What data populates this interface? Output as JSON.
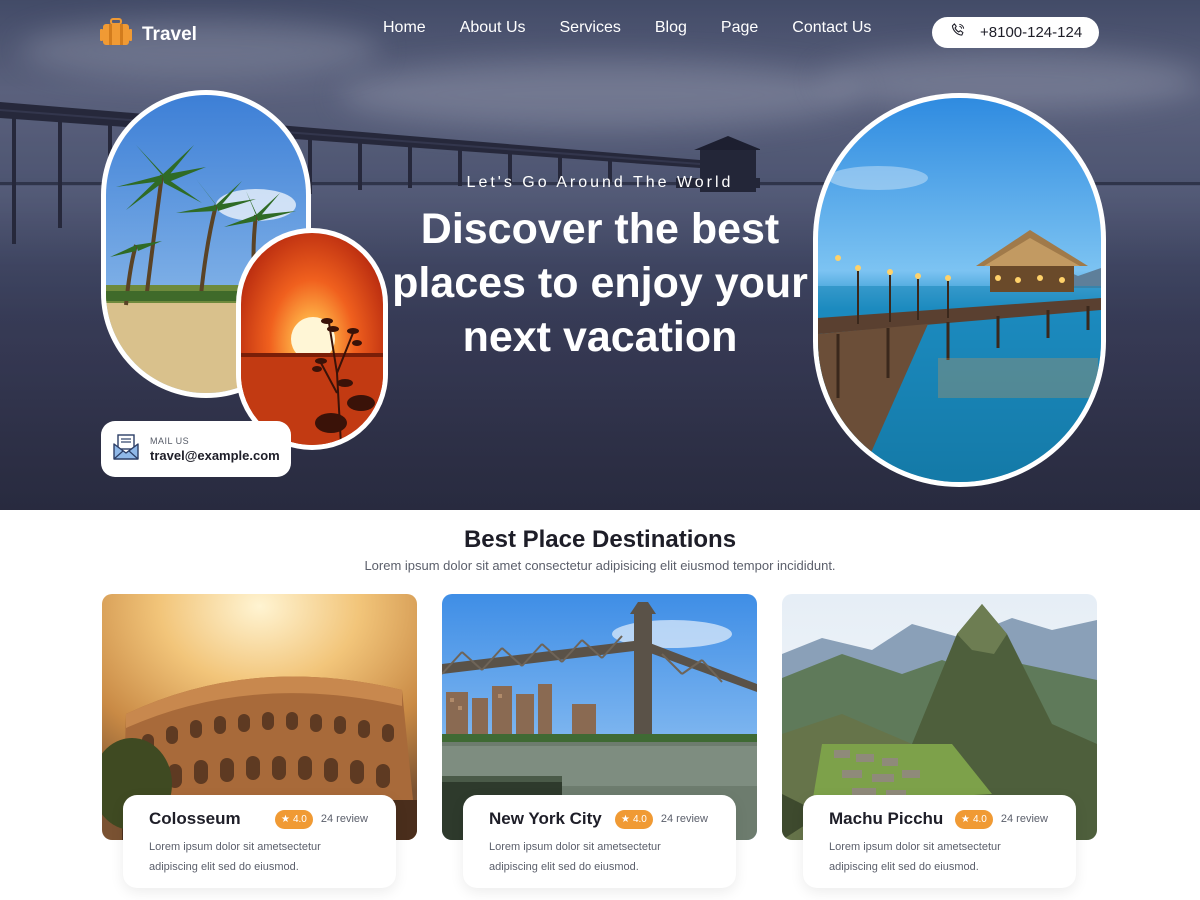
{
  "brand": {
    "name": "Travel",
    "logo_icon": "suitcase-icon",
    "accent": "#f09a34"
  },
  "nav": {
    "items": [
      "Home",
      "About Us",
      "Services",
      "Blog",
      "Page",
      "Contact Us"
    ]
  },
  "phone": {
    "icon": "phone-icon",
    "number": "+8100-124-124"
  },
  "hero": {
    "tagline": "Let's Go Around The World",
    "headline": "Discover the best places to enjoy your next vacation"
  },
  "mail": {
    "icon": "mail-icon",
    "label": "MAIL US",
    "email": "travel@example.com"
  },
  "destinations": {
    "title": "Best Place Destinations",
    "subtitle": "Lorem ipsum dolor sit amet consectetur adipisicing elit eiusmod tempor incididunt.",
    "cards": [
      {
        "name": "Colosseum",
        "rating": "4.0",
        "reviews": "24 review",
        "description": "Lorem ipsum dolor sit ametsectetur adipiscing elit sed do eiusmod."
      },
      {
        "name": "New York City",
        "rating": "4.0",
        "reviews": "24 review",
        "description": "Lorem ipsum dolor sit ametsectetur adipiscing elit sed do eiusmod."
      },
      {
        "name": "Machu Picchu",
        "rating": "4.0",
        "reviews": "24 review",
        "description": "Lorem ipsum dolor sit ametsectetur adipiscing elit sed do eiusmod."
      }
    ]
  }
}
